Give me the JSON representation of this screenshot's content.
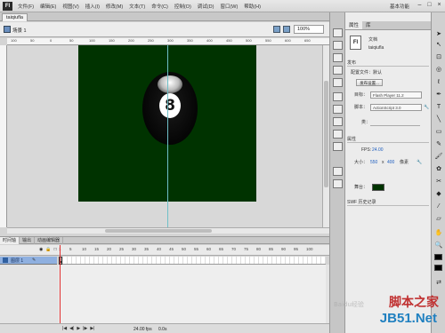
{
  "app": {
    "logo": "Fl"
  },
  "menu": {
    "items": [
      "文件(F)",
      "编辑(E)",
      "视图(V)",
      "插入(I)",
      "修改(M)",
      "文本(T)",
      "命令(C)",
      "控制(O)",
      "调试(D)",
      "窗口(W)",
      "帮助(H)"
    ],
    "workspace": "基本功能"
  },
  "window_controls": [
    "–",
    "□",
    "×"
  ],
  "document": {
    "tab": "taiqiufla",
    "scene": "场景 1",
    "zoom": "100%"
  },
  "ruler_ticks": [
    "100",
    "50",
    "0",
    "50",
    "100",
    "150",
    "200",
    "250",
    "300",
    "350",
    "400",
    "450",
    "500",
    "550",
    "600",
    "650"
  ],
  "stage": {
    "ball_number": "8",
    "background_color": "#003300"
  },
  "timeline": {
    "tabs": [
      "时间轴",
      "输出",
      "动画编辑器"
    ],
    "frame_numbers": [
      "1",
      "5",
      "10",
      "15",
      "20",
      "25",
      "30",
      "35",
      "40",
      "45",
      "50",
      "55",
      "60",
      "65",
      "70",
      "75",
      "80",
      "85",
      "90",
      "95",
      "100"
    ],
    "layer": {
      "name": "图层 1",
      "pencil": "✎"
    },
    "footer": {
      "controls": [
        "|◀",
        "◀|",
        "▶",
        "|▶",
        "▶|"
      ],
      "fps": "24.00",
      "fps_unit": "fps",
      "time": "0.0s",
      "frame": "1"
    },
    "col_icons": [
      "◉",
      "🔒",
      "□"
    ]
  },
  "properties": {
    "tabs": [
      "属性",
      "库"
    ],
    "doc_icon": "Fl",
    "doc_type": "文档",
    "doc_name": "taiqiufla",
    "publish_section": "发布",
    "profile_label": "配置文件：默认",
    "publish_settings_button": "发布设置...",
    "target_label": "目标：",
    "target_value": "Flash Player 11.2",
    "script_label": "脚本：",
    "script_value": "ActionScript 3.0",
    "class_label": "类：",
    "props_section": "属性",
    "fps_label": "FPS:",
    "fps_value": "24.00",
    "size_label": "大小：",
    "size_w": "550",
    "size_x": "x",
    "size_h": "400",
    "size_unit": "像素",
    "stage_label": "舞台：",
    "history_section": "SWF 历史记录"
  },
  "watermark": {
    "line1": "脚本之家",
    "line2": "JB51.Net",
    "line3": "Baidu经验"
  }
}
